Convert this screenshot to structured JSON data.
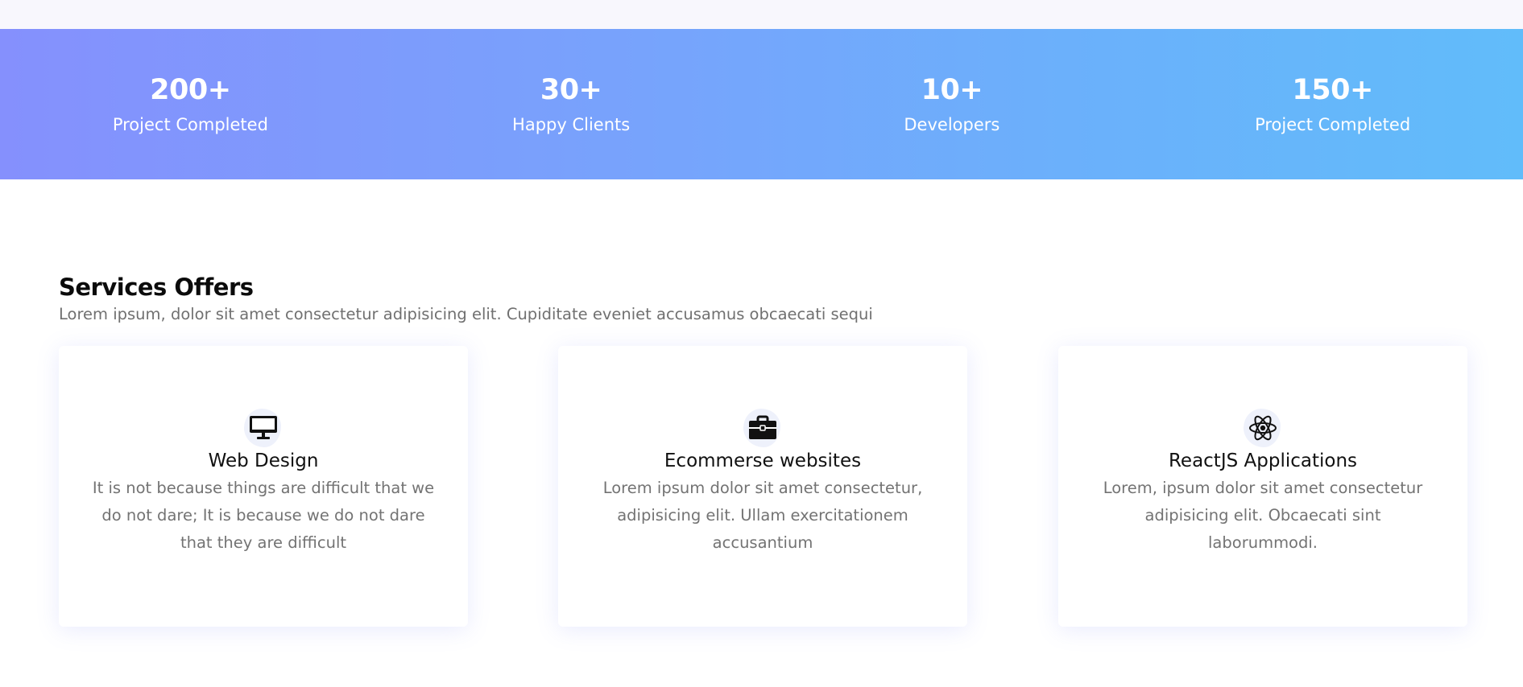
{
  "stats": [
    {
      "value": "200+",
      "label": "Project Completed"
    },
    {
      "value": "30+",
      "label": "Happy Clients"
    },
    {
      "value": "10+",
      "label": "Developers"
    },
    {
      "value": "150+",
      "label": "Project Completed"
    }
  ],
  "services": {
    "title": "Services Offers",
    "subtitle": "Lorem ipsum, dolor sit amet consectetur adipisicing elit. Cupiditate eveniet accusamus obcaecati sequi",
    "cards": [
      {
        "icon": "desktop-icon",
        "title": "Web Design",
        "text": "It is not because things are difficult that we do not dare; It is because we do not dare that they are difficult"
      },
      {
        "icon": "briefcase-icon",
        "title": "Ecommerse websites",
        "text": "Lorem ipsum dolor sit amet consectetur, adipisicing elit. Ullam exercitationem accusantium"
      },
      {
        "icon": "react-icon",
        "title": "ReactJS Applications",
        "text": "Lorem, ipsum dolor sit amet consectetur adipisicing elit. Obcaecati sint laborummodi."
      }
    ]
  },
  "colors": {
    "gradient_start": "#8590fd",
    "gradient_end": "#61bcfa",
    "icon_background": "#eef1fb",
    "text_muted": "#737373"
  }
}
